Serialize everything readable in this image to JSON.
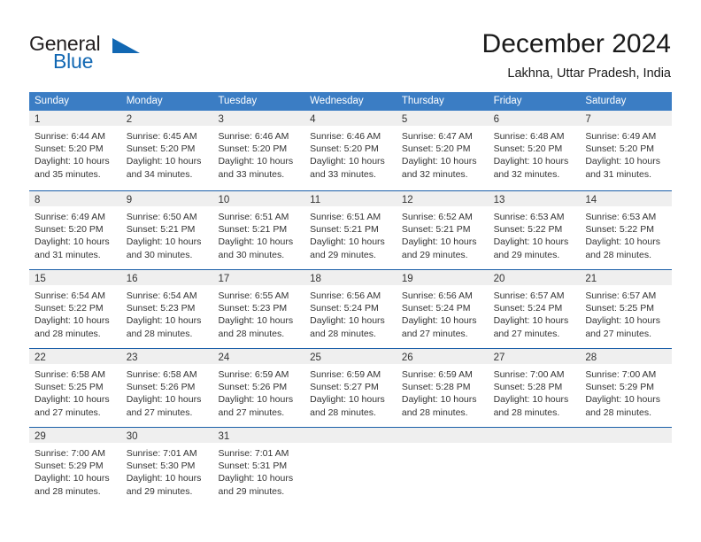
{
  "logo": {
    "word_top": "General",
    "word_bottom": "Blue",
    "triangle_icon": "triangle-icon",
    "color_dark": "#231f20",
    "color_blue": "#1268b3"
  },
  "header": {
    "title": "December 2024",
    "subtitle": "Lakhna, Uttar Pradesh, India"
  },
  "theme": {
    "header_bar": "#3b7dc4",
    "row_divider": "#1b5fa8",
    "day_band": "#efefef",
    "text": "#333333"
  },
  "weekdays": [
    "Sunday",
    "Monday",
    "Tuesday",
    "Wednesday",
    "Thursday",
    "Friday",
    "Saturday"
  ],
  "weeks": [
    [
      {
        "day": "1",
        "lines": [
          "Sunrise: 6:44 AM",
          "Sunset: 5:20 PM",
          "Daylight: 10 hours",
          "and 35 minutes."
        ]
      },
      {
        "day": "2",
        "lines": [
          "Sunrise: 6:45 AM",
          "Sunset: 5:20 PM",
          "Daylight: 10 hours",
          "and 34 minutes."
        ]
      },
      {
        "day": "3",
        "lines": [
          "Sunrise: 6:46 AM",
          "Sunset: 5:20 PM",
          "Daylight: 10 hours",
          "and 33 minutes."
        ]
      },
      {
        "day": "4",
        "lines": [
          "Sunrise: 6:46 AM",
          "Sunset: 5:20 PM",
          "Daylight: 10 hours",
          "and 33 minutes."
        ]
      },
      {
        "day": "5",
        "lines": [
          "Sunrise: 6:47 AM",
          "Sunset: 5:20 PM",
          "Daylight: 10 hours",
          "and 32 minutes."
        ]
      },
      {
        "day": "6",
        "lines": [
          "Sunrise: 6:48 AM",
          "Sunset: 5:20 PM",
          "Daylight: 10 hours",
          "and 32 minutes."
        ]
      },
      {
        "day": "7",
        "lines": [
          "Sunrise: 6:49 AM",
          "Sunset: 5:20 PM",
          "Daylight: 10 hours",
          "and 31 minutes."
        ]
      }
    ],
    [
      {
        "day": "8",
        "lines": [
          "Sunrise: 6:49 AM",
          "Sunset: 5:20 PM",
          "Daylight: 10 hours",
          "and 31 minutes."
        ]
      },
      {
        "day": "9",
        "lines": [
          "Sunrise: 6:50 AM",
          "Sunset: 5:21 PM",
          "Daylight: 10 hours",
          "and 30 minutes."
        ]
      },
      {
        "day": "10",
        "lines": [
          "Sunrise: 6:51 AM",
          "Sunset: 5:21 PM",
          "Daylight: 10 hours",
          "and 30 minutes."
        ]
      },
      {
        "day": "11",
        "lines": [
          "Sunrise: 6:51 AM",
          "Sunset: 5:21 PM",
          "Daylight: 10 hours",
          "and 29 minutes."
        ]
      },
      {
        "day": "12",
        "lines": [
          "Sunrise: 6:52 AM",
          "Sunset: 5:21 PM",
          "Daylight: 10 hours",
          "and 29 minutes."
        ]
      },
      {
        "day": "13",
        "lines": [
          "Sunrise: 6:53 AM",
          "Sunset: 5:22 PM",
          "Daylight: 10 hours",
          "and 29 minutes."
        ]
      },
      {
        "day": "14",
        "lines": [
          "Sunrise: 6:53 AM",
          "Sunset: 5:22 PM",
          "Daylight: 10 hours",
          "and 28 minutes."
        ]
      }
    ],
    [
      {
        "day": "15",
        "lines": [
          "Sunrise: 6:54 AM",
          "Sunset: 5:22 PM",
          "Daylight: 10 hours",
          "and 28 minutes."
        ]
      },
      {
        "day": "16",
        "lines": [
          "Sunrise: 6:54 AM",
          "Sunset: 5:23 PM",
          "Daylight: 10 hours",
          "and 28 minutes."
        ]
      },
      {
        "day": "17",
        "lines": [
          "Sunrise: 6:55 AM",
          "Sunset: 5:23 PM",
          "Daylight: 10 hours",
          "and 28 minutes."
        ]
      },
      {
        "day": "18",
        "lines": [
          "Sunrise: 6:56 AM",
          "Sunset: 5:24 PM",
          "Daylight: 10 hours",
          "and 28 minutes."
        ]
      },
      {
        "day": "19",
        "lines": [
          "Sunrise: 6:56 AM",
          "Sunset: 5:24 PM",
          "Daylight: 10 hours",
          "and 27 minutes."
        ]
      },
      {
        "day": "20",
        "lines": [
          "Sunrise: 6:57 AM",
          "Sunset: 5:24 PM",
          "Daylight: 10 hours",
          "and 27 minutes."
        ]
      },
      {
        "day": "21",
        "lines": [
          "Sunrise: 6:57 AM",
          "Sunset: 5:25 PM",
          "Daylight: 10 hours",
          "and 27 minutes."
        ]
      }
    ],
    [
      {
        "day": "22",
        "lines": [
          "Sunrise: 6:58 AM",
          "Sunset: 5:25 PM",
          "Daylight: 10 hours",
          "and 27 minutes."
        ]
      },
      {
        "day": "23",
        "lines": [
          "Sunrise: 6:58 AM",
          "Sunset: 5:26 PM",
          "Daylight: 10 hours",
          "and 27 minutes."
        ]
      },
      {
        "day": "24",
        "lines": [
          "Sunrise: 6:59 AM",
          "Sunset: 5:26 PM",
          "Daylight: 10 hours",
          "and 27 minutes."
        ]
      },
      {
        "day": "25",
        "lines": [
          "Sunrise: 6:59 AM",
          "Sunset: 5:27 PM",
          "Daylight: 10 hours",
          "and 28 minutes."
        ]
      },
      {
        "day": "26",
        "lines": [
          "Sunrise: 6:59 AM",
          "Sunset: 5:28 PM",
          "Daylight: 10 hours",
          "and 28 minutes."
        ]
      },
      {
        "day": "27",
        "lines": [
          "Sunrise: 7:00 AM",
          "Sunset: 5:28 PM",
          "Daylight: 10 hours",
          "and 28 minutes."
        ]
      },
      {
        "day": "28",
        "lines": [
          "Sunrise: 7:00 AM",
          "Sunset: 5:29 PM",
          "Daylight: 10 hours",
          "and 28 minutes."
        ]
      }
    ],
    [
      {
        "day": "29",
        "lines": [
          "Sunrise: 7:00 AM",
          "Sunset: 5:29 PM",
          "Daylight: 10 hours",
          "and 28 minutes."
        ]
      },
      {
        "day": "30",
        "lines": [
          "Sunrise: 7:01 AM",
          "Sunset: 5:30 PM",
          "Daylight: 10 hours",
          "and 29 minutes."
        ]
      },
      {
        "day": "31",
        "lines": [
          "Sunrise: 7:01 AM",
          "Sunset: 5:31 PM",
          "Daylight: 10 hours",
          "and 29 minutes."
        ]
      },
      {
        "day": "",
        "lines": []
      },
      {
        "day": "",
        "lines": []
      },
      {
        "day": "",
        "lines": []
      },
      {
        "day": "",
        "lines": []
      }
    ]
  ]
}
